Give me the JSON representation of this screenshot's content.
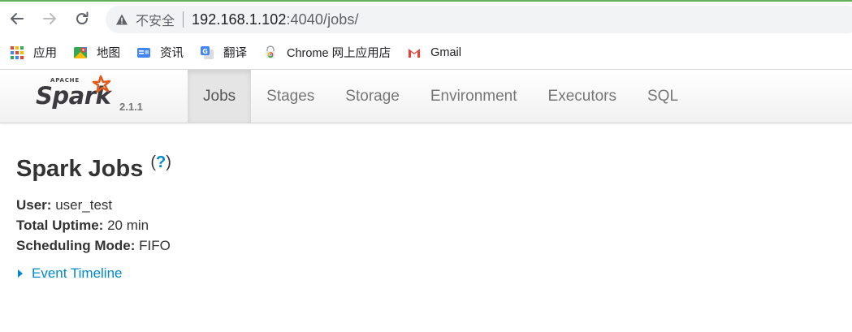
{
  "browser": {
    "security_label": "不安全",
    "url_host": "192.168.1.102",
    "url_path": ":4040/jobs/",
    "bookmarks": [
      {
        "label": "应用",
        "icon": "apps-grid-icon"
      },
      {
        "label": "地图",
        "icon": "maps-icon"
      },
      {
        "label": "资讯",
        "icon": "news-icon"
      },
      {
        "label": "翻译",
        "icon": "translate-icon"
      },
      {
        "label": "Chrome 网上应用店",
        "icon": "chrome-webstore-icon"
      },
      {
        "label": "Gmail",
        "icon": "gmail-icon"
      }
    ]
  },
  "spark": {
    "logo_small": "APACHE",
    "logo_text": "Spark",
    "version": "2.1.1",
    "tabs": [
      {
        "label": "Jobs",
        "active": true
      },
      {
        "label": "Stages",
        "active": false
      },
      {
        "label": "Storage",
        "active": false
      },
      {
        "label": "Environment",
        "active": false
      },
      {
        "label": "Executors",
        "active": false
      },
      {
        "label": "SQL",
        "active": false
      }
    ]
  },
  "page": {
    "title": "Spark Jobs",
    "help_open": "(",
    "help_q": "?",
    "help_close": ")",
    "details": [
      {
        "label": "User:",
        "value": "user_test"
      },
      {
        "label": "Total Uptime:",
        "value": "20 min"
      },
      {
        "label": "Scheduling Mode:",
        "value": "FIFO"
      }
    ],
    "event_timeline": "Event Timeline"
  },
  "colors": {
    "link": "#0088cc",
    "accent_green": "#63b05a",
    "spark_orange": "#e25a1c"
  }
}
